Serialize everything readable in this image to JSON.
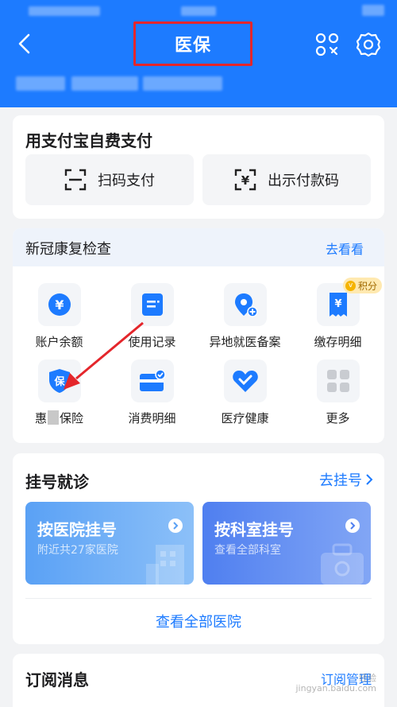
{
  "header": {
    "title": "医保",
    "back_icon": "chevron-left-icon",
    "scan_icon": "scan-icon",
    "settings_icon": "gear-icon",
    "background": "#1d7bff"
  },
  "self_pay": {
    "title": "用支付宝自费支付",
    "scan_pay_label": "扫码支付",
    "show_code_label": "出示付款码"
  },
  "covid": {
    "title": "新冠康复检查",
    "link": "去看看"
  },
  "services": [
    {
      "label": "账户余额",
      "icon": "yen-coin-icon"
    },
    {
      "label": "使用记录",
      "icon": "record-card-icon"
    },
    {
      "label": "异地就医备案",
      "icon": "location-plus-icon"
    },
    {
      "label": "缴存明细",
      "icon": "receipt-icon",
      "badge": "积分",
      "badge_mark": "v"
    },
    {
      "label_before": "惠",
      "label_after": "保险",
      "icon": "shield-icon",
      "icon_text": "保"
    },
    {
      "label": "消费明细",
      "icon": "card-check-icon"
    },
    {
      "label": "医疗健康",
      "icon": "heart-icon"
    },
    {
      "label": "更多",
      "icon": "grid-icon"
    }
  ],
  "registration": {
    "title": "挂号就诊",
    "link": "去挂号",
    "by_hospital": {
      "title": "按医院挂号",
      "subtitle": "附近共27家医院"
    },
    "by_department": {
      "title": "按科室挂号",
      "subtitle": "查看全部科室"
    },
    "view_all": "查看全部医院"
  },
  "subscription": {
    "title": "订阅消息",
    "link": "订阅管理"
  },
  "watermark": {
    "line1": "经验",
    "line2": "jingyan.baidu.com"
  },
  "colors": {
    "accent": "#1d7bff",
    "highlight_box": "#e4262b",
    "arrow": "#e4262b"
  }
}
